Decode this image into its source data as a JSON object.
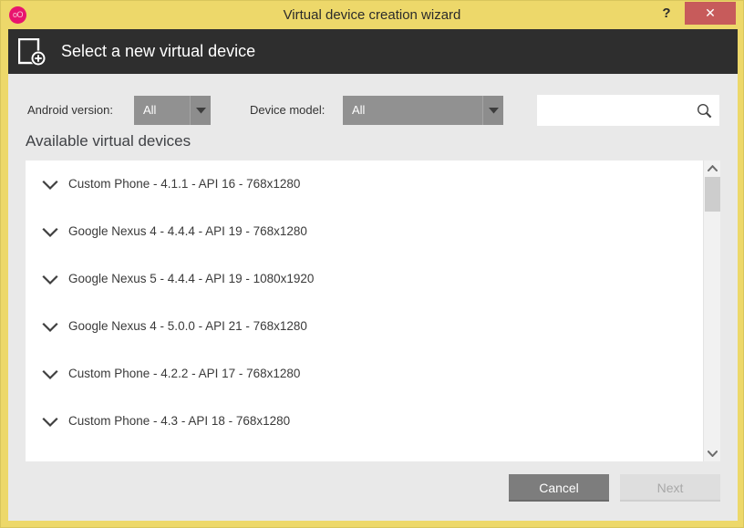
{
  "window": {
    "title": "Virtual device creation wizard",
    "app_icon": "oO",
    "help_label": "?",
    "close_label": "✕",
    "accent_yellow": "#edd86a",
    "header_dark": "#2e2e2e",
    "close_red": "#c75b5b",
    "app_icon_pink": "#e8146e"
  },
  "header": {
    "title": "Select a new virtual device",
    "icon": "device-add-icon"
  },
  "filters": {
    "android_version": {
      "label": "Android version:",
      "value": "All",
      "options": [
        "All"
      ]
    },
    "device_model": {
      "label": "Device model:",
      "value": "All",
      "options": [
        "All"
      ]
    },
    "search": {
      "value": "",
      "placeholder": "",
      "icon": "search-icon"
    }
  },
  "list": {
    "section_title": "Available virtual devices",
    "items": [
      {
        "label": "Custom Phone - 4.1.1 - API 16 - 768x1280"
      },
      {
        "label": "Google Nexus 4 - 4.4.4 - API 19 - 768x1280"
      },
      {
        "label": "Google Nexus 5 - 4.4.4 - API 19 - 1080x1920"
      },
      {
        "label": "Google Nexus 4 - 5.0.0 - API 21 - 768x1280"
      },
      {
        "label": "Custom Phone - 4.2.2 - API 17 - 768x1280"
      },
      {
        "label": "Custom Phone - 4.3 - API 18 - 768x1280"
      }
    ]
  },
  "footer": {
    "cancel_label": "Cancel",
    "next_label": "Next"
  }
}
